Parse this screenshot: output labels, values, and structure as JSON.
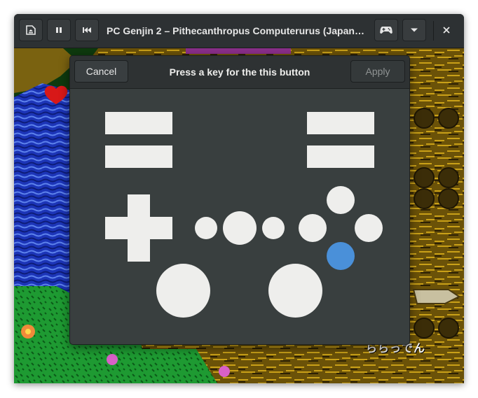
{
  "window": {
    "title": "PC Genjin 2 – Pithecanthropus Computerurus (Japan)...."
  },
  "headerbar": {
    "left_buttons": [
      {
        "icon": "media-eject-icon"
      },
      {
        "icon": "pause-icon"
      },
      {
        "icon": "skip-backward-icon"
      }
    ],
    "right_buttons": [
      {
        "icon": "gamepad-icon"
      },
      {
        "icon": "chevron-down-icon"
      },
      {
        "icon": "close-icon"
      }
    ]
  },
  "game": {
    "score_text": "ららっでん"
  },
  "dialog": {
    "cancel_label": "Cancel",
    "title": "Press a key for the this button",
    "apply_label": "Apply",
    "highlighted_button": "face-button-bottom",
    "colors": {
      "button_fill": "#eeeeec",
      "highlight": "#4a90d9",
      "background": "#393f3f"
    }
  }
}
